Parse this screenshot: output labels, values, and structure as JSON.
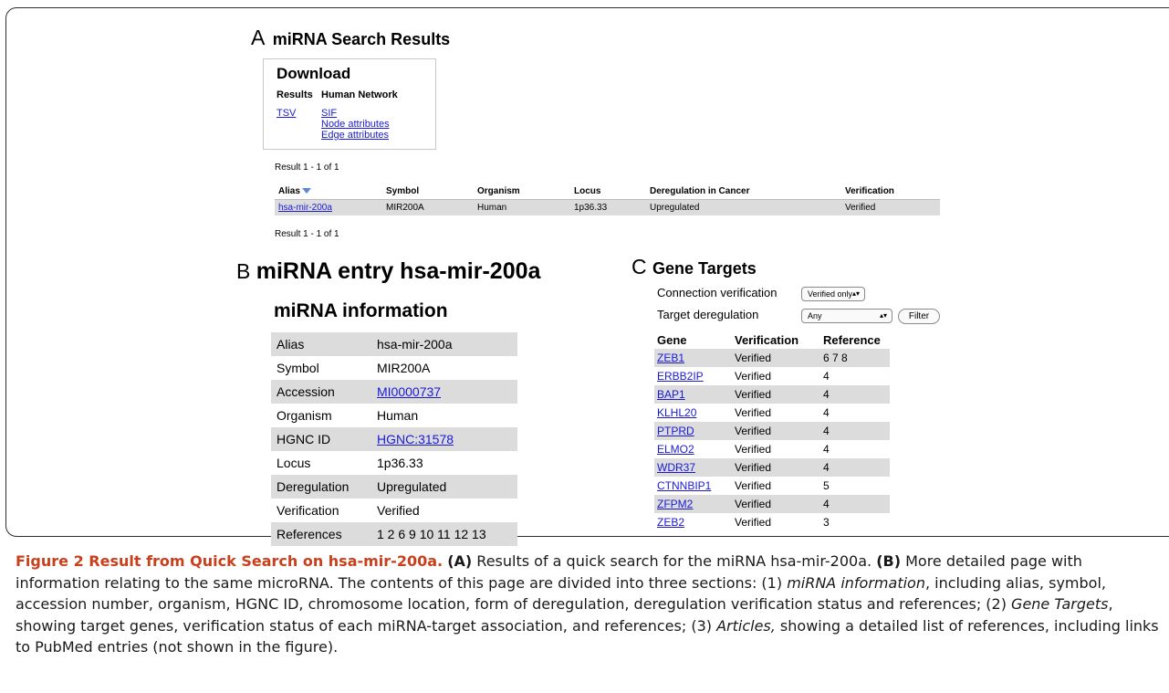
{
  "panel_a": {
    "letter": "A",
    "title": "miRNA Search Results",
    "download": {
      "title": "Download",
      "results_header": "Results",
      "network_header": "Human Network",
      "results_link": "TSV",
      "network_links": [
        "SIF",
        "Node attributes",
        "Edge attributes"
      ]
    },
    "result_count_top": "Result 1 - 1 of 1",
    "result_count_bottom": "Result 1 - 1 of 1",
    "table": {
      "headers": [
        "Alias",
        "Symbol",
        "Organism",
        "Locus",
        "Deregulation in Cancer",
        "Verification"
      ],
      "rows": [
        [
          "hsa-mir-200a",
          "MIR200A",
          "Human",
          "1p36.33",
          "Upregulated",
          "Verified"
        ]
      ]
    }
  },
  "panel_b": {
    "letter": "B",
    "title": "miRNA entry hsa-mir-200a",
    "section_title": "miRNA information",
    "info": [
      {
        "key": "Alias",
        "value": "hsa-mir-200a"
      },
      {
        "key": "Symbol",
        "value": "MIR200A"
      },
      {
        "key": "Accession",
        "value": "MI0000737",
        "link": true
      },
      {
        "key": "Organism",
        "value": "Human"
      },
      {
        "key": "HGNC ID",
        "value": "HGNC:31578",
        "link": true
      },
      {
        "key": "Locus",
        "value": "1p36.33"
      },
      {
        "key": "Deregulation",
        "value": "Upregulated"
      },
      {
        "key": "Verification",
        "value": "Verified"
      },
      {
        "key": "References",
        "value": "1 2 6 9 10 11 12 13"
      }
    ]
  },
  "panel_c": {
    "letter": "C",
    "title": "Gene Targets",
    "filters": {
      "connection_label": "Connection verification",
      "connection_value": "Verified only",
      "target_label": "Target deregulation",
      "target_value": "Any",
      "filter_button": "Filter"
    },
    "headers": [
      "Gene",
      "Verification",
      "Reference"
    ],
    "rows": [
      [
        "ZEB1",
        "Verified",
        "6 7 8"
      ],
      [
        "ERBB2IP",
        "Verified",
        "4"
      ],
      [
        "BAP1",
        "Verified",
        "4"
      ],
      [
        "KLHL20",
        "Verified",
        "4"
      ],
      [
        "PTPRD",
        "Verified",
        "4"
      ],
      [
        "ELMO2",
        "Verified",
        "4"
      ],
      [
        "WDR37",
        "Verified",
        "4"
      ],
      [
        "CTNNBIP1",
        "Verified",
        "5"
      ],
      [
        "ZFPM2",
        "Verified",
        "4"
      ],
      [
        "ZEB2",
        "Verified",
        "3"
      ]
    ]
  },
  "caption": {
    "figure_label": "Figure 2 Result from Quick Search on hsa-mir-200a.",
    "a_label": "(A)",
    "a_text": " Results of a quick search for the miRNA hsa-mir-200a. ",
    "b_label": "(B)",
    "b_text_1": " More detailed page with information relating to the same microRNA. The contents of this page are divided into three sections: (1) ",
    "b_em_1": "miRNA information",
    "b_text_2": ", including alias, symbol, accession number, organism, HGNC ID, chromosome location, form of deregulation, deregulation verification status and references; (2) ",
    "b_em_2": "Gene Targets",
    "b_text_3": ", showing target genes, verification status of each miRNA-target association, and references; (3) ",
    "b_em_3": "Articles,",
    "b_text_4": " showing a detailed list of references, including links to PubMed entries (not shown in the figure)."
  },
  "colors": {
    "link": "#1a1ad6",
    "row_shade": "#dcdcdc",
    "figure_label": "#c8401c"
  }
}
